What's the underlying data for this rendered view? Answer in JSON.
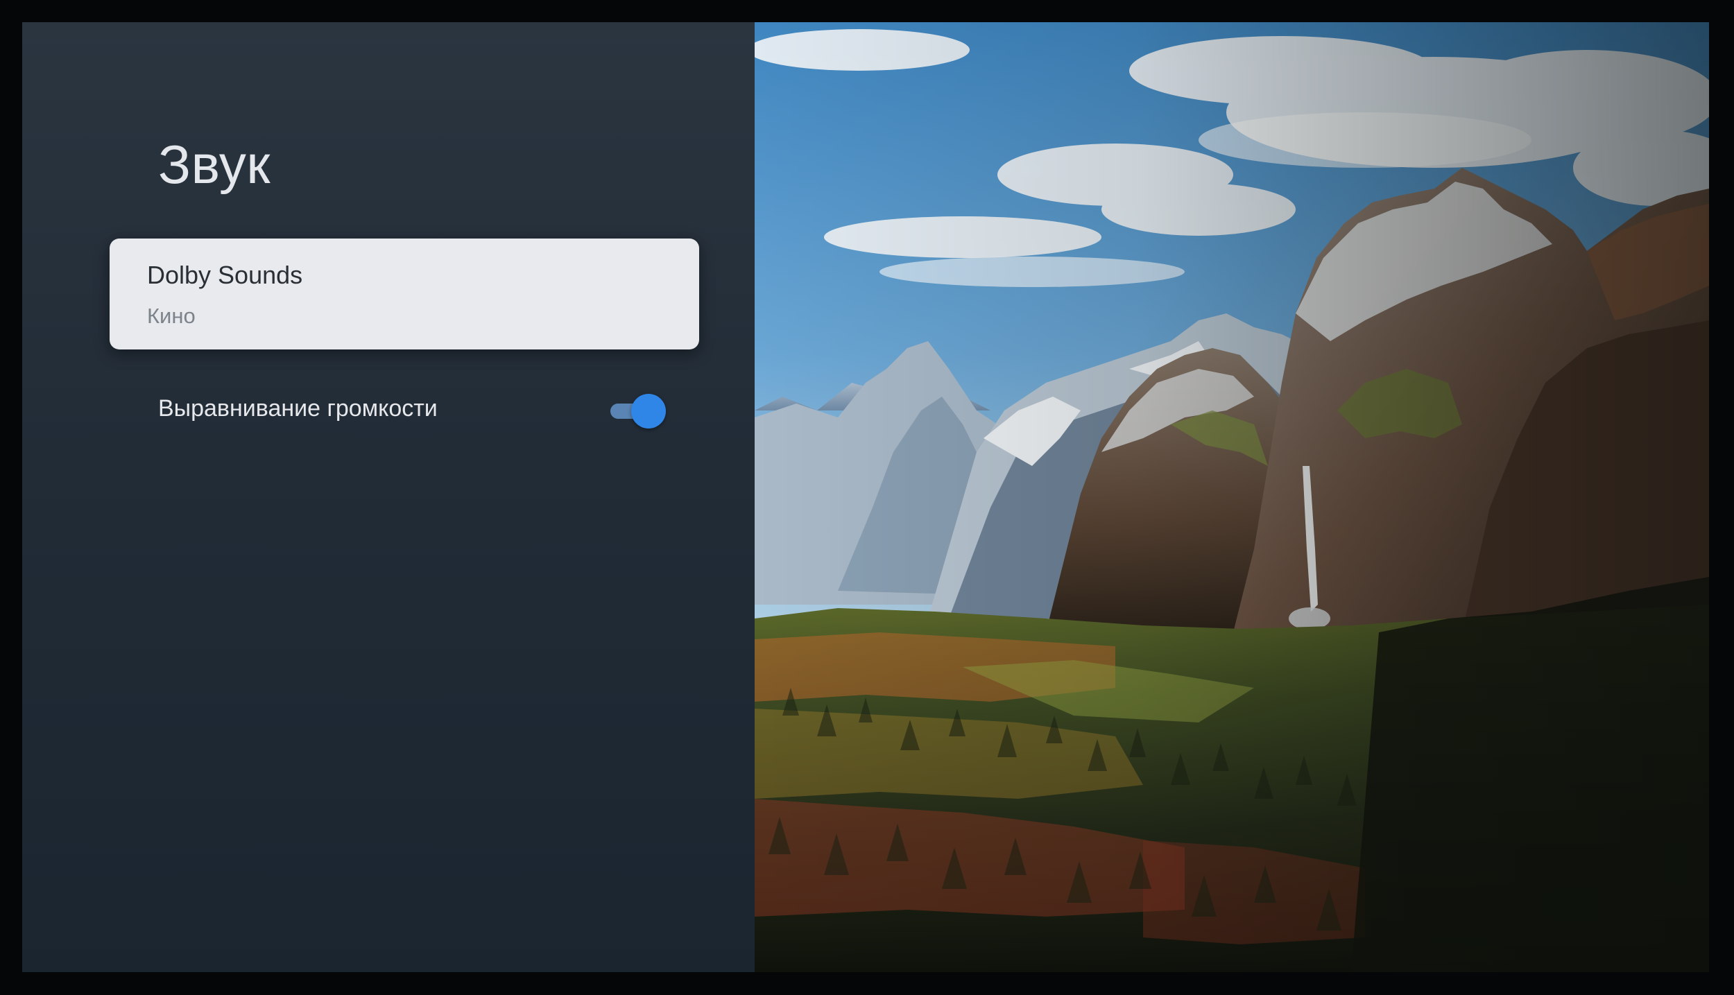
{
  "settings": {
    "title": "Звук",
    "dolby": {
      "label": "Dolby Sounds",
      "value": "Кино"
    },
    "volume_leveling": {
      "label": "Выравнивание громкости",
      "enabled": true
    }
  },
  "colors": {
    "panel_background": "#222c37",
    "card_background": "#e8eaee",
    "toggle_accent": "#2f86e6"
  },
  "wallpaper": {
    "icon": "mountain-valley-landscape"
  }
}
